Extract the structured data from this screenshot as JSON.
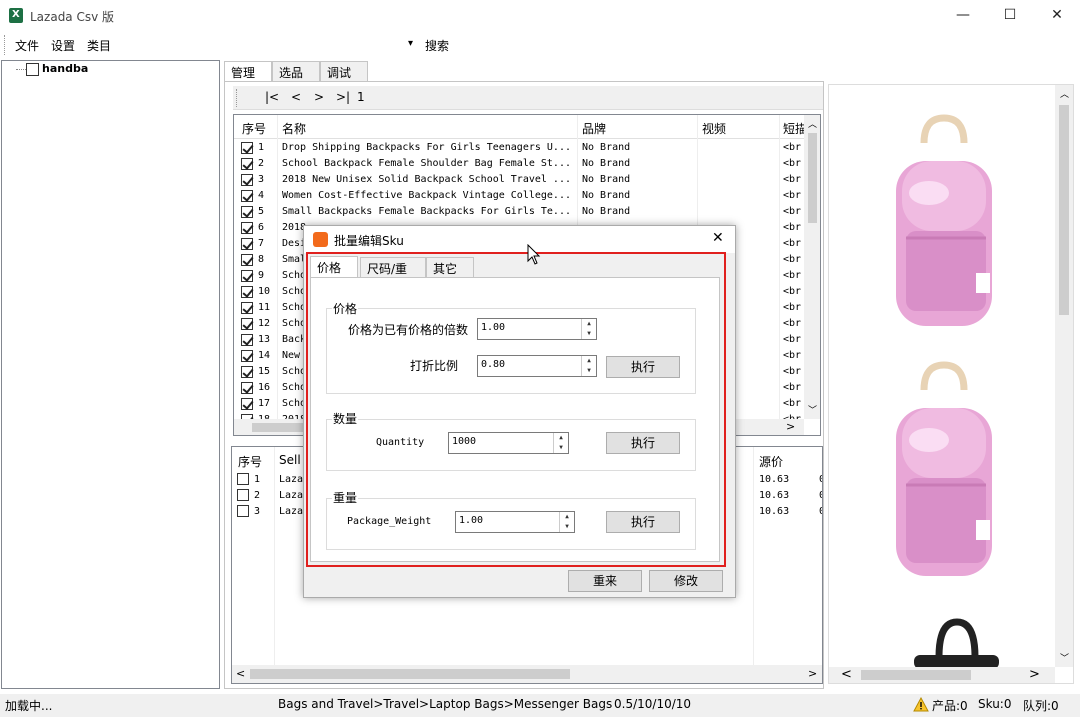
{
  "window": {
    "title": "Lazada Csv 版",
    "minimize": "—",
    "maximize": "☐",
    "close": "✕"
  },
  "menu": {
    "file": "文件",
    "settings": "设置",
    "category": "类目",
    "search": "搜索",
    "dropdown": "▾"
  },
  "tree": {
    "root_label": "handba"
  },
  "tabs": [
    "管理",
    "选品",
    "调试"
  ],
  "pager": {
    "first": "|<",
    "prev": "<",
    "next": ">",
    "last": ">|",
    "page": "1"
  },
  "top_grid": {
    "headers": [
      "序号",
      "名称",
      "品牌",
      "视频",
      "短描"
    ],
    "rows": [
      {
        "n": "1",
        "name": "Drop Shipping Backpacks For Girls Teenagers U...",
        "brand": "No Brand",
        "short": "<br"
      },
      {
        "n": "2",
        "name": "School Backpack Female Shoulder Bag Female St...",
        "brand": "No Brand",
        "short": "<br"
      },
      {
        "n": "3",
        "name": "2018 New Unisex Solid Backpack School Travel ...",
        "brand": "No Brand",
        "short": "<br"
      },
      {
        "n": "4",
        "name": "Women Cost-Effective Backpack Vintage College...",
        "brand": "No Brand",
        "short": "<br"
      },
      {
        "n": "5",
        "name": "Small Backpacks Female Backpacks For Girls Te...",
        "brand": "No Brand",
        "short": "<br"
      },
      {
        "n": "6",
        "name": "2018",
        "brand": "",
        "short": "<br"
      },
      {
        "n": "7",
        "name": "Desi",
        "brand": "",
        "short": "<br"
      },
      {
        "n": "8",
        "name": "Smal",
        "brand": "",
        "short": "<br"
      },
      {
        "n": "9",
        "name": "Scho",
        "brand": "",
        "short": "<br"
      },
      {
        "n": "10",
        "name": "Scho",
        "brand": "",
        "short": "<br"
      },
      {
        "n": "11",
        "name": "Scho",
        "brand": "",
        "short": "<br"
      },
      {
        "n": "12",
        "name": "Scho",
        "brand": "",
        "short": "<br"
      },
      {
        "n": "13",
        "name": "Back",
        "brand": "",
        "short": "<br"
      },
      {
        "n": "14",
        "name": "New",
        "brand": "",
        "short": "<br"
      },
      {
        "n": "15",
        "name": "Scho",
        "brand": "",
        "short": "<br"
      },
      {
        "n": "16",
        "name": "Scho",
        "brand": "",
        "short": "<br"
      },
      {
        "n": "17",
        "name": "Scho",
        "brand": "",
        "short": "<br"
      },
      {
        "n": "18",
        "name": "2018",
        "brand": "",
        "short": "<br"
      }
    ]
  },
  "bottom_grid": {
    "headers": [
      "序号",
      "Sell",
      "源价"
    ],
    "rows": [
      {
        "n": "1",
        "seller": "Laza",
        "price": "10.63",
        "extra": "0"
      },
      {
        "n": "2",
        "seller": "Laza",
        "price": "10.63",
        "extra": "0"
      },
      {
        "n": "3",
        "seller": "Laza",
        "price": "10.63",
        "extra": "0"
      }
    ]
  },
  "dialog": {
    "title": "批量编辑Sku",
    "tabs": [
      "价格",
      "尺码/重量",
      "其它"
    ],
    "price_group": "价格",
    "multiplier_label": "价格为已有价格的倍数",
    "multiplier_value": "1.00",
    "discount_label": "打折比例",
    "discount_value": "0.80",
    "quantity_group": "数量",
    "quantity_label": "Quantity",
    "quantity_value": "1000",
    "weight_group": "重量",
    "weight_label": "Package_Weight",
    "weight_value": "1.00",
    "execute": "执行",
    "reset": "重来",
    "modify": "修改",
    "close": "✕"
  },
  "status": {
    "loading": "加载中...",
    "category_path": "Bags and Travel>Travel>Laptop Bags>Messenger Bags",
    "dims": "0.5/10/10/10",
    "products": "产品:0",
    "sku": "Sku:0",
    "queue": "队列:0"
  },
  "colors": {
    "accent_red": "#e0201e",
    "backpack_pink": "#e8a6d6",
    "excel_green": "#1d7044"
  }
}
